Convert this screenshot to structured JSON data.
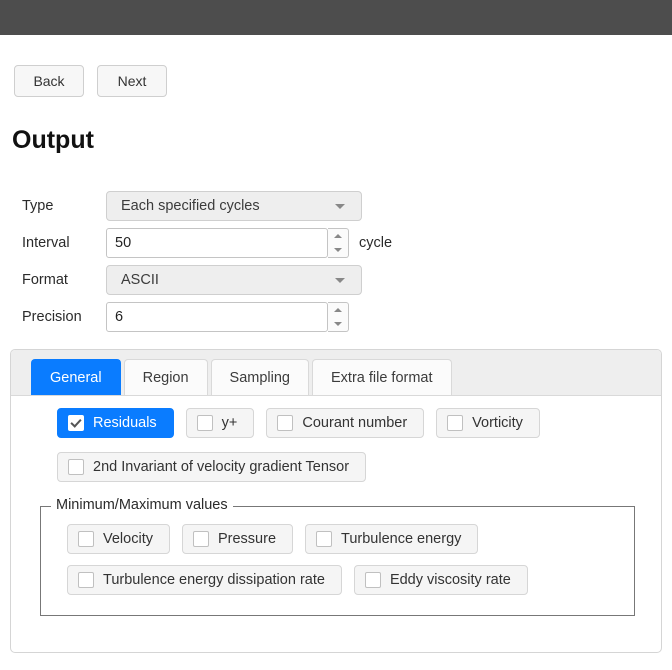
{
  "titlebar": {
    "color": "#4d4d4d"
  },
  "nav": {
    "back_label": "Back",
    "next_label": "Next"
  },
  "page": {
    "title": "Output"
  },
  "form": {
    "type": {
      "label": "Type",
      "value": "Each specified cycles",
      "options": [
        "Each specified cycles"
      ]
    },
    "interval": {
      "label": "Interval",
      "value": "50",
      "unit": "cycle"
    },
    "format": {
      "label": "Format",
      "value": "ASCII",
      "options": [
        "ASCII"
      ]
    },
    "precision": {
      "label": "Precision",
      "value": "6"
    }
  },
  "tabs": [
    {
      "label": "General",
      "active": true
    },
    {
      "label": "Region",
      "active": false
    },
    {
      "label": "Sampling",
      "active": false
    },
    {
      "label": "Extra file format",
      "active": false
    }
  ],
  "general": {
    "row1": [
      {
        "label": "Residuals",
        "checked": true
      },
      {
        "label": "y+",
        "checked": false
      },
      {
        "label": "Courant number",
        "checked": false
      },
      {
        "label": "Vorticity",
        "checked": false
      }
    ],
    "row2": [
      {
        "label": "2nd Invariant of velocity gradient Tensor",
        "checked": false
      }
    ],
    "minmax": {
      "title": "Minimum/Maximum values",
      "row1": [
        {
          "label": "Velocity",
          "checked": false
        },
        {
          "label": "Pressure",
          "checked": false
        },
        {
          "label": "Turbulence energy",
          "checked": false
        }
      ],
      "row2": [
        {
          "label": "Turbulence energy dissipation rate",
          "checked": false
        },
        {
          "label": "Eddy viscosity rate",
          "checked": false
        }
      ]
    }
  },
  "colors": {
    "accent": "#0a7cff",
    "titlebar": "#4d4d4d",
    "panel_border": "#d5d5d5",
    "groupbox_border": "#777777"
  }
}
